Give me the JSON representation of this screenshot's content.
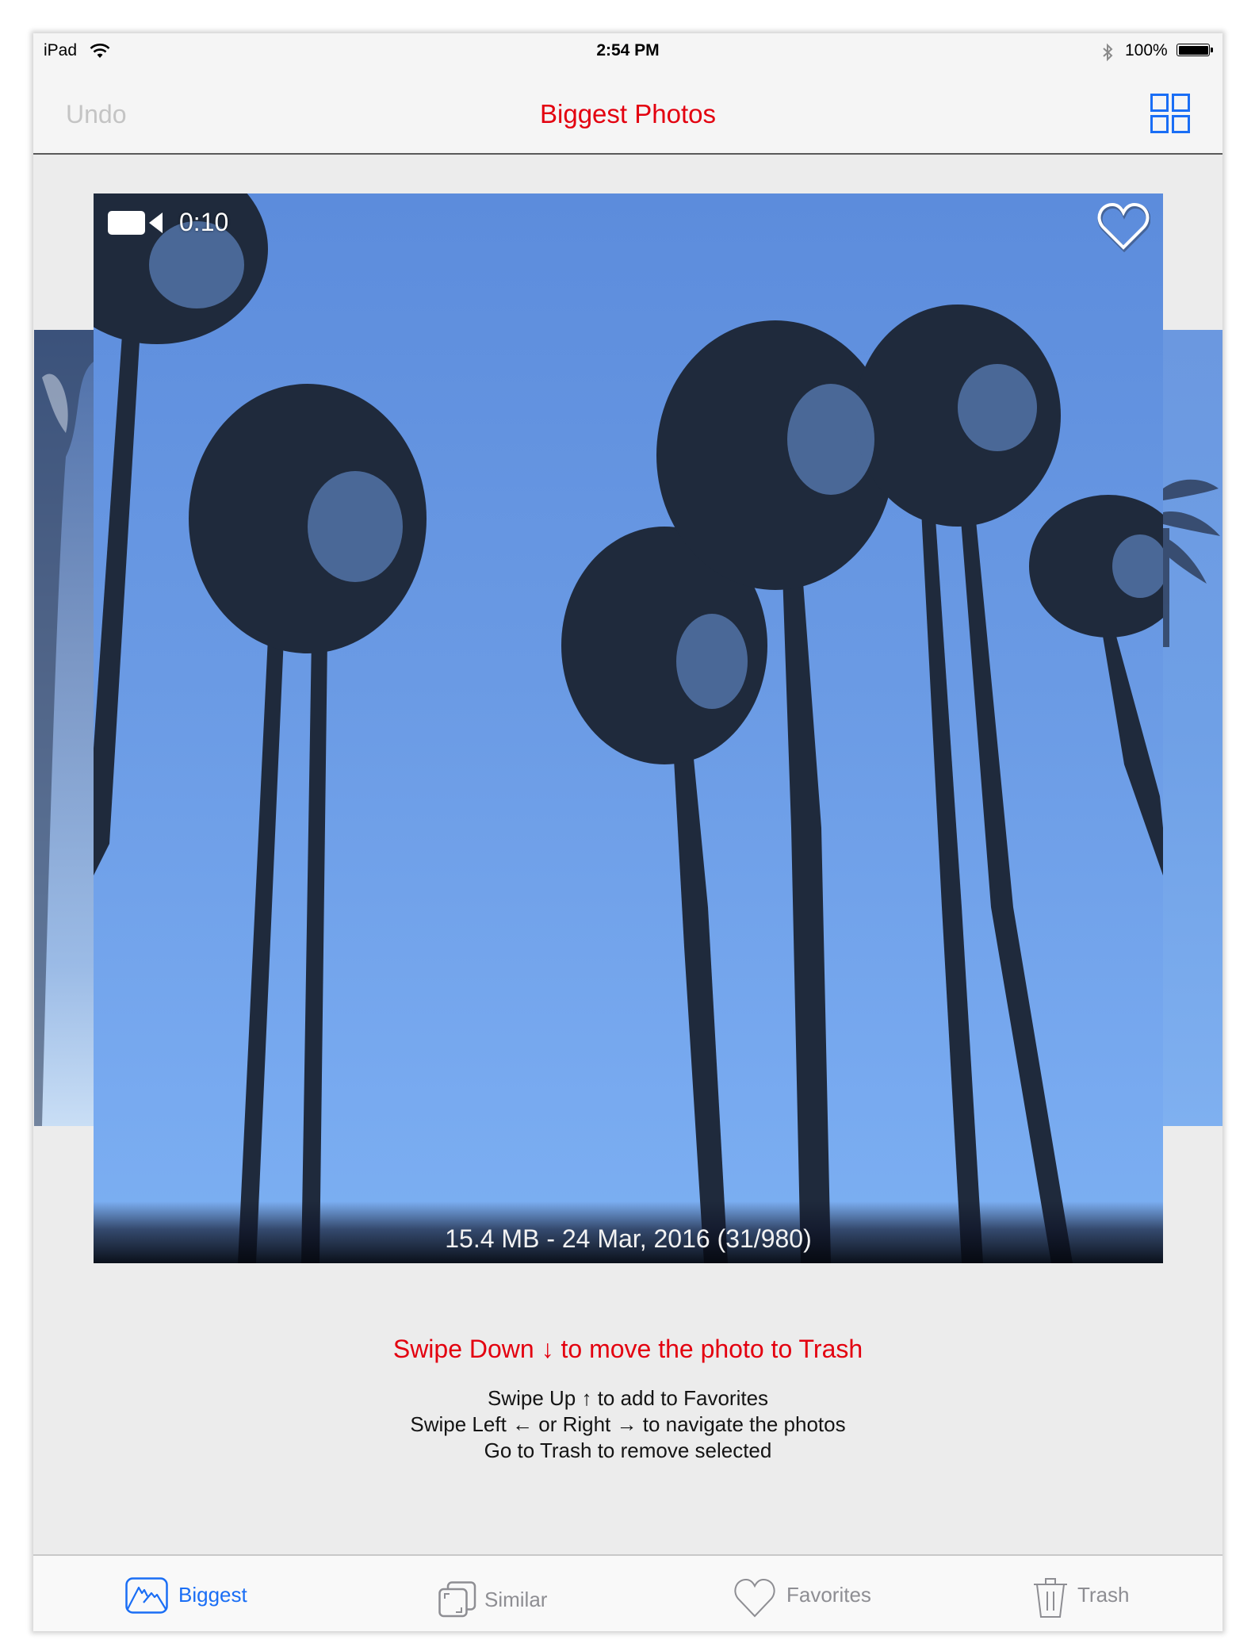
{
  "status_bar": {
    "carrier": "iPad",
    "wifi_icon": "wifi-icon",
    "time": "2:54 PM",
    "bluetooth_icon": "bluetooth-icon",
    "battery_percent": "100%",
    "battery_level": 1.0
  },
  "nav": {
    "undo_label": "Undo",
    "title": "Biggest Photos",
    "grid_icon": "grid-view-icon"
  },
  "photo": {
    "is_video": true,
    "video_icon": "video-camera-icon",
    "duration": "0:10",
    "favorite_icon": "heart-outline-icon",
    "caption": "15.4 MB - 24 Mar, 2016 (31/980)",
    "file_size": "15.4 MB",
    "date": "24 Mar, 2016",
    "index": 31,
    "total": 980
  },
  "instructions": {
    "primary": "Swipe Down ↓ to move the photo to Trash",
    "secondary": [
      "Swipe Up ↑ to add to Favorites",
      "Swipe Left ← or Right → to navigate the photos",
      "Go to Trash to remove selected"
    ]
  },
  "tabs": [
    {
      "label": "Biggest",
      "icon": "mountains-photo-icon",
      "active": true
    },
    {
      "label": "Similar",
      "icon": "stacked-photos-icon",
      "active": false
    },
    {
      "label": "Favorites",
      "icon": "heart-icon",
      "active": false
    },
    {
      "label": "Trash",
      "icon": "trash-icon",
      "active": false
    }
  ],
  "colors": {
    "accent_red": "#e3000f",
    "accent_blue": "#1a6ef5",
    "inactive_gray": "#8e8e93",
    "disabled_gray": "#c4c4c4"
  }
}
